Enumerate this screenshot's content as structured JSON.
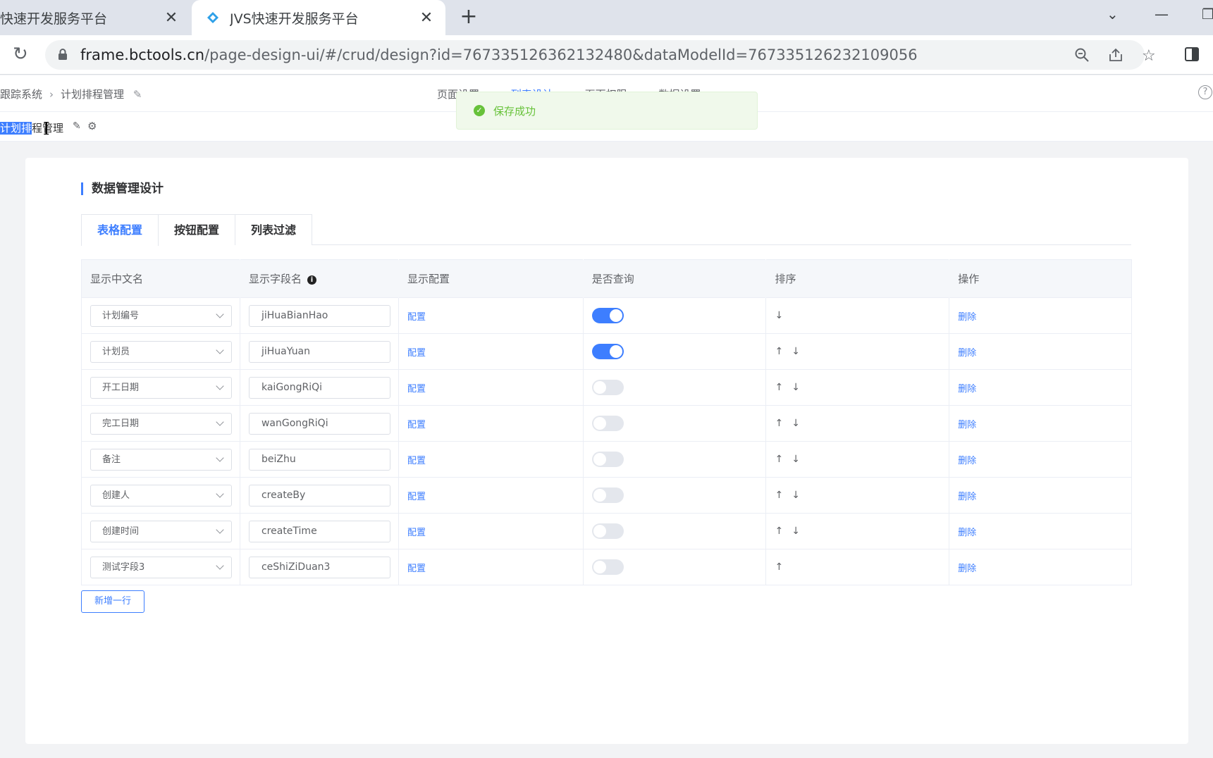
{
  "browser": {
    "tabs": [
      {
        "title": "快速开发服务平台",
        "active": false
      },
      {
        "title": "JVS快速开发服务平台",
        "active": true
      }
    ],
    "url_host": "frame.bctools.cn",
    "url_path": "/page-design-ui/#/crud/design?id=767335126362132480&dataModelId=767335126232109056"
  },
  "header": {
    "breadcrumb": [
      "跟踪系统",
      "计划排程管理"
    ],
    "nav": [
      "页面设置",
      "列表设计",
      "页面权限",
      "数据设置"
    ],
    "active_nav": 1
  },
  "page": {
    "name_selected": "计划排",
    "name_rest": "程管理"
  },
  "toast": {
    "message": "保存成功",
    "color": "#67c23a"
  },
  "section": {
    "title": "数据管理设计",
    "tabs": [
      "表格配置",
      "按钮配置",
      "列表过滤"
    ],
    "active_tab": 0
  },
  "table": {
    "columns": [
      "显示中文名",
      "显示字段名",
      "显示配置",
      "是否查询",
      "排序",
      "操作"
    ],
    "rows": [
      {
        "label": "计划编号",
        "field": "jiHuaBianHao",
        "config": "配置",
        "query": true,
        "up": false,
        "down": true,
        "action": "删除"
      },
      {
        "label": "计划员",
        "field": "jiHuaYuan",
        "config": "配置",
        "query": true,
        "up": true,
        "down": true,
        "action": "删除"
      },
      {
        "label": "开工日期",
        "field": "kaiGongRiQi",
        "config": "配置",
        "query": false,
        "up": true,
        "down": true,
        "action": "删除"
      },
      {
        "label": "完工日期",
        "field": "wanGongRiQi",
        "config": "配置",
        "query": false,
        "up": true,
        "down": true,
        "action": "删除"
      },
      {
        "label": "备注",
        "field": "beiZhu",
        "config": "配置",
        "query": false,
        "up": true,
        "down": true,
        "action": "删除"
      },
      {
        "label": "创建人",
        "field": "createBy",
        "config": "配置",
        "query": false,
        "up": true,
        "down": true,
        "action": "删除"
      },
      {
        "label": "创建时间",
        "field": "createTime",
        "config": "配置",
        "query": false,
        "up": true,
        "down": true,
        "action": "删除"
      },
      {
        "label": "测试字段3",
        "field": "ceShiZiDuan3",
        "config": "配置",
        "query": false,
        "up": true,
        "down": false,
        "action": "删除"
      }
    ]
  },
  "add_row_label": "新增一行",
  "colors": {
    "accent": "#3d7eff",
    "success": "#67c23a"
  }
}
